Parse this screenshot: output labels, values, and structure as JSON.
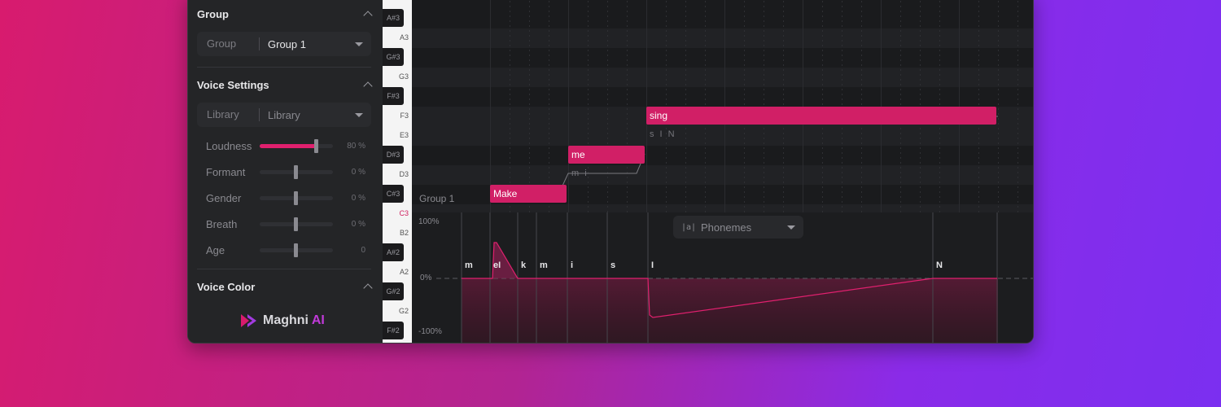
{
  "sidebar": {
    "group_section": {
      "title": "Group",
      "select_label": "Group",
      "select_value": "Group 1"
    },
    "voice_section": {
      "title": "Voice Settings",
      "library_label": "Library",
      "library_value": "Library",
      "sliders": [
        {
          "name": "Loudness",
          "value": "80 %",
          "level": 0.8
        },
        {
          "name": "Formant",
          "value": "0 %",
          "level": 0.5
        },
        {
          "name": "Gender",
          "value": "0 %",
          "level": 0.5
        },
        {
          "name": "Breath",
          "value": "0 %",
          "level": 0.5
        },
        {
          "name": "Age",
          "value": "0",
          "level": 0.5
        }
      ]
    },
    "color_section": {
      "title": "Voice Color"
    },
    "brand": {
      "name": "Maghni",
      "suffix": "AI"
    }
  },
  "piano": {
    "white_labels": [
      "A3",
      "G3",
      "F3",
      "E3",
      "D3",
      "C3",
      "B2",
      "A2",
      "G2"
    ],
    "black_labels": [
      "A#3",
      "G#3",
      "F#3",
      "D#3",
      "C#3",
      "A#2",
      "G#2",
      "F#2"
    ]
  },
  "roll": {
    "group_label": "Group 1",
    "notes": [
      {
        "lyric": "Make",
        "phonemes": "m eI"
      },
      {
        "lyric": "me",
        "phonemes": "m i"
      },
      {
        "lyric": "sing",
        "phonemes": "s I N"
      }
    ]
  },
  "param_panel": {
    "top_pct": "100%",
    "mid_pct": "0%",
    "bottom_pct": "-100%",
    "select_icon": "|a|",
    "select_value": "Phonemes",
    "phonemes": [
      "m",
      "eI",
      "k",
      "m",
      "i",
      "s",
      "I",
      "N"
    ]
  },
  "colors": {
    "accent": "#d11f66",
    "brand_ai": "#c03ad8"
  }
}
